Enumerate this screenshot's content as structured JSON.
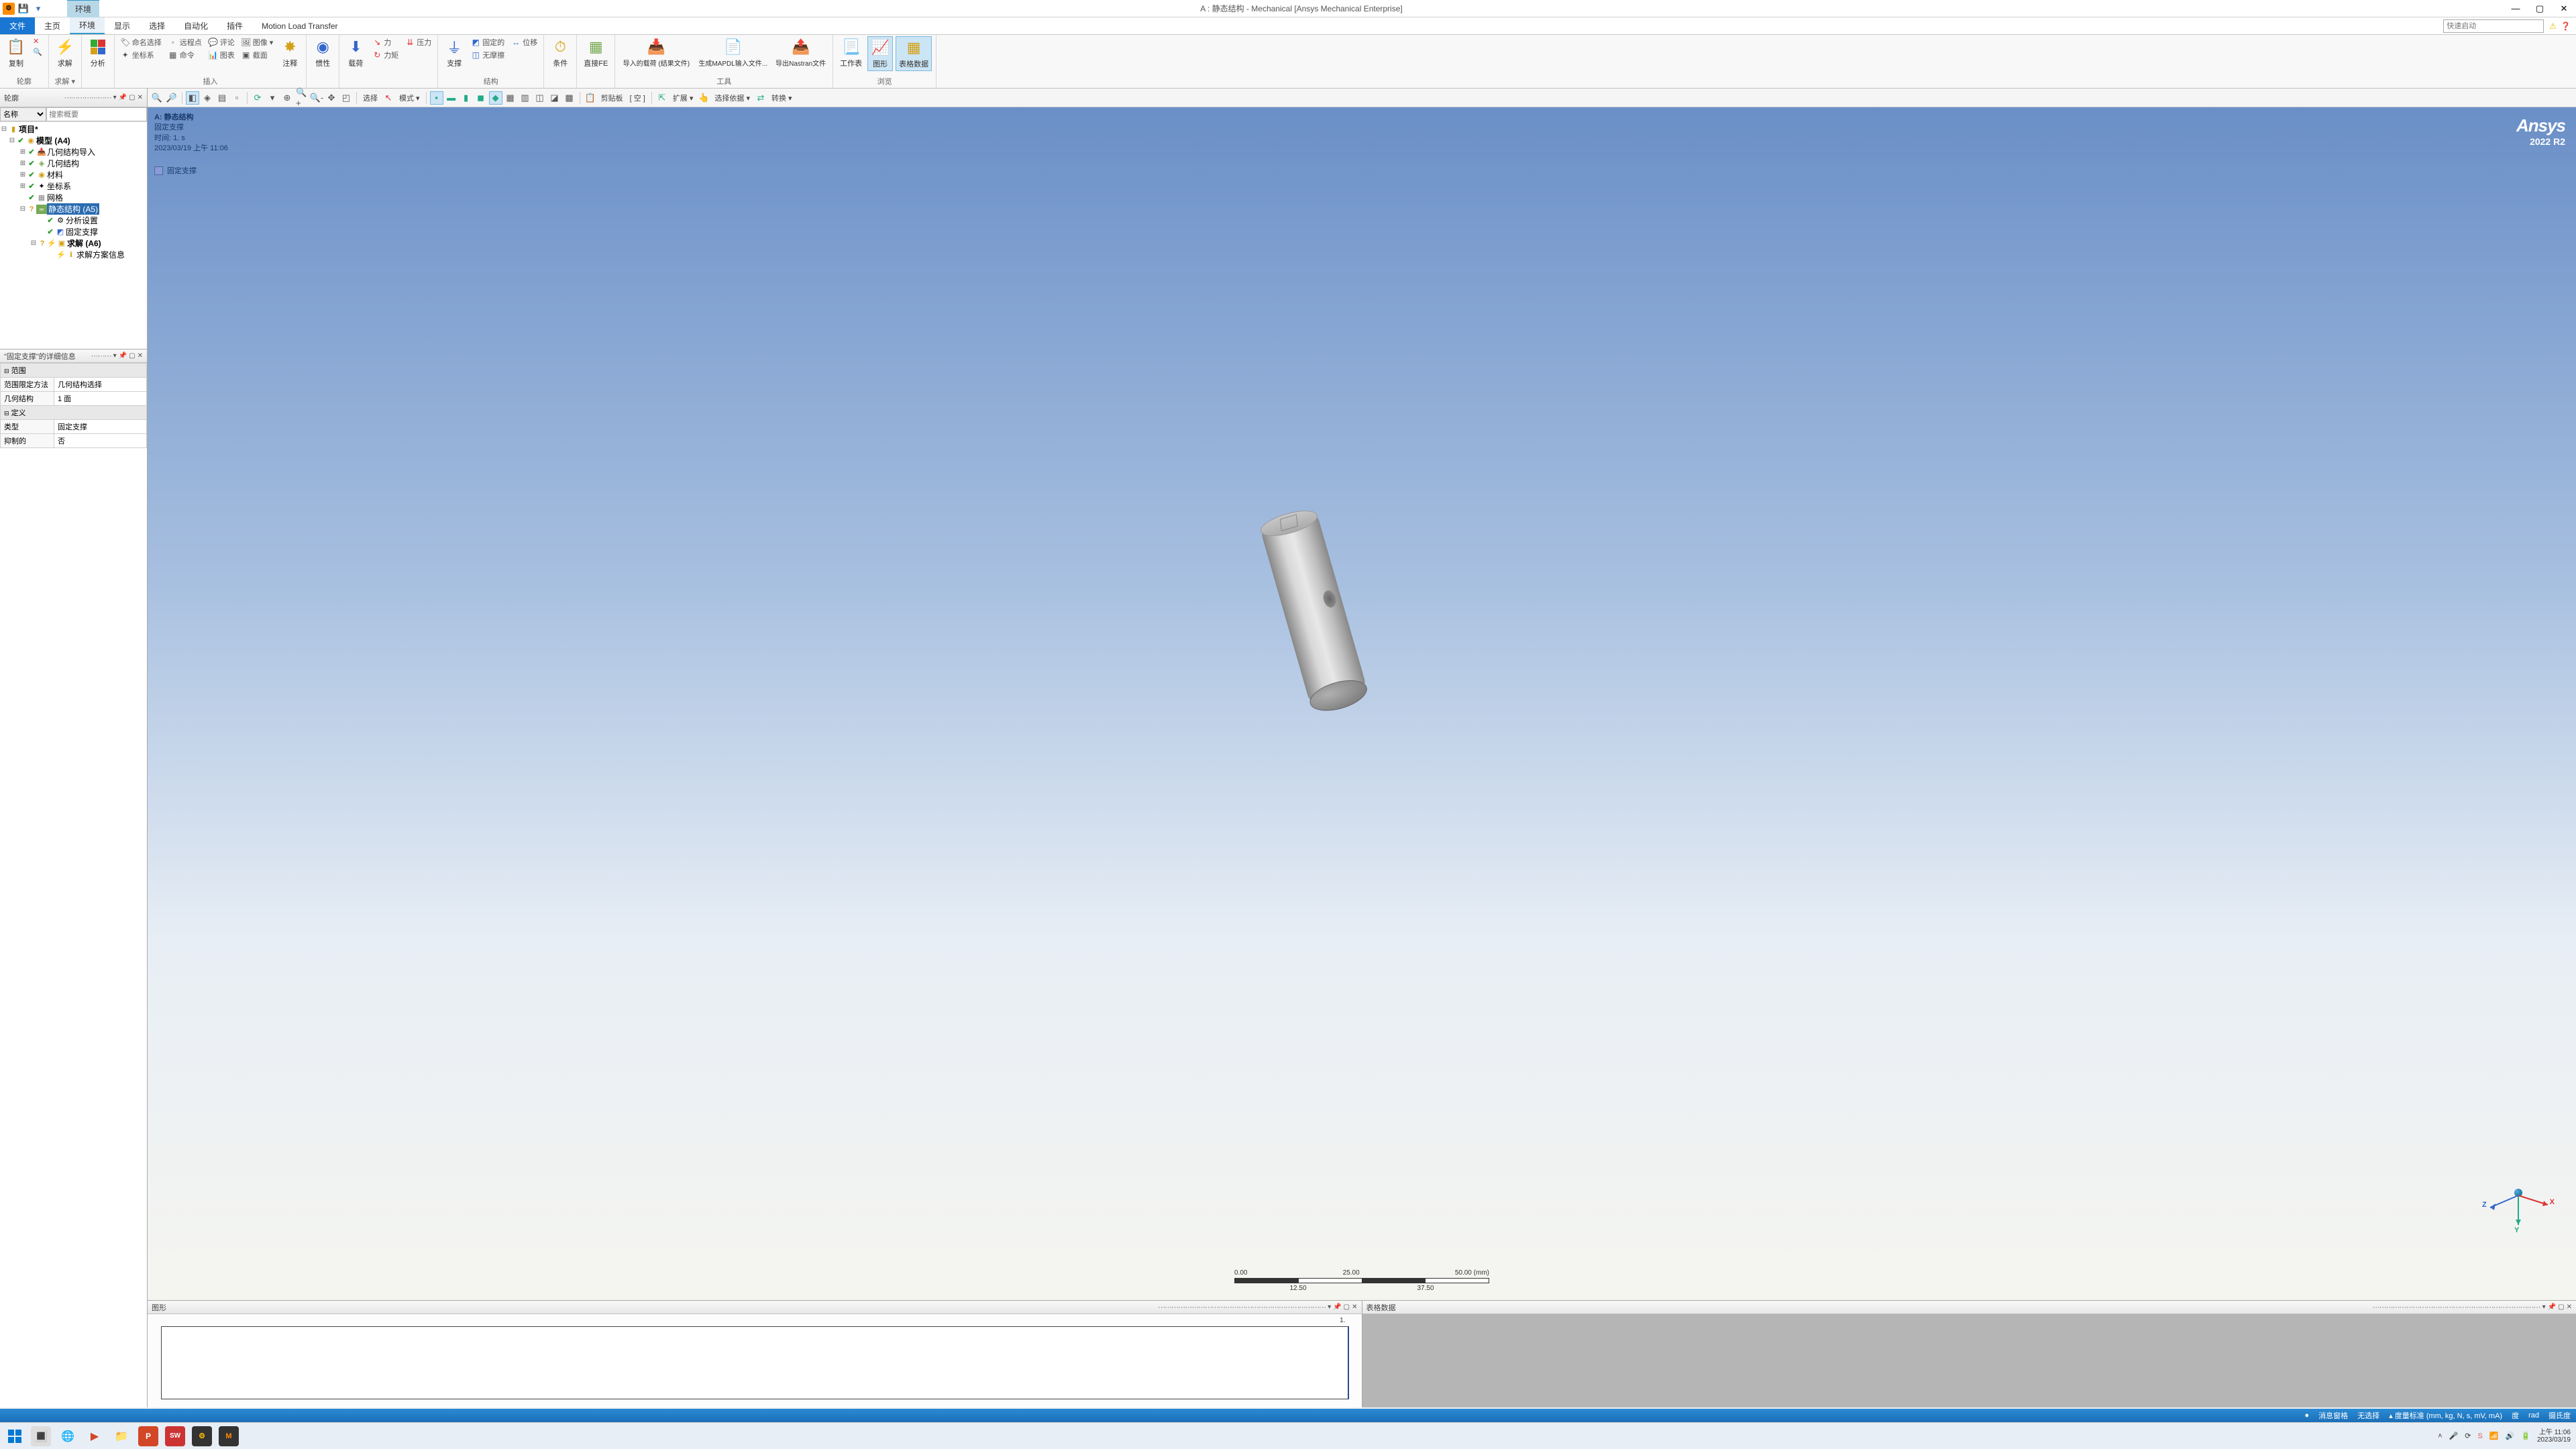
{
  "app": {
    "title": "A : 静态结构 - Mechanical [Ansys Mechanical Enterprise]",
    "context_tab": "环境",
    "logo_brand": "Ansys",
    "logo_version": "2022 R2"
  },
  "menu": {
    "file": "文件",
    "tabs": [
      "主页",
      "环境",
      "显示",
      "选择",
      "自动化",
      "插件",
      "Motion Load Transfer"
    ],
    "active": "环境",
    "quick_launch_placeholder": "快速启动"
  },
  "ribbon": {
    "g_outline": {
      "copy": "复制",
      "q": "Q",
      "label": "轮廓"
    },
    "g_solve": {
      "solve": "求解",
      "label": "求解 ▾"
    },
    "g_analysis": {
      "analyze": "分析",
      "label": ""
    },
    "g_insert": {
      "name_sel": "命名选择",
      "remote_pt": "远程点",
      "comment": "评论",
      "image": "图像 ▾",
      "coord": "坐标系",
      "cmd": "命令",
      "chart": "图表",
      "section": "截面",
      "annot": "注释",
      "label": "插入"
    },
    "g_inertia": {
      "inertia": "惯性",
      "label": ""
    },
    "g_loads": {
      "loads": "载荷",
      "force": "力",
      "moment": "力矩",
      "pressure": "压力",
      "label": ""
    },
    "g_support": {
      "support": "支撑",
      "fixed": "固定的",
      "frictionless": "无摩擦",
      "disp": "位移",
      "label": "结构"
    },
    "g_cond": {
      "cond": "条件",
      "label": ""
    },
    "g_fe": {
      "fe": "直接FE",
      "label": ""
    },
    "g_tools": {
      "import_load": "导入的载荷 (结果文件)",
      "mapdl": "生成MAPDL输入文件...",
      "nastran": "导出Nastran文件",
      "label": "工具"
    },
    "g_view": {
      "ws": "工作表",
      "graph": "图形",
      "table": "表格数据",
      "label": "浏览"
    }
  },
  "toolbar2": {
    "select": "选择",
    "mode": "模式 ▾",
    "clipboard": "剪贴板",
    "empty": "[ 空 ]",
    "extend": "扩展 ▾",
    "sel_by": "选择依据 ▾",
    "convert": "转换 ▾"
  },
  "outline": {
    "title": "轮廓",
    "name_filter": "名称",
    "search_placeholder": "搜索概要",
    "project": "项目*",
    "model": "模型 (A4)",
    "geom_import": "几何结构导入",
    "geometry": "几何结构",
    "materials": "材料",
    "coord_sys": "坐标系",
    "mesh": "网格",
    "static_struct": "静态结构 (A5)",
    "analysis_settings": "分析设置",
    "fixed_support": "固定支撑",
    "solution": "求解 (A6)",
    "solution_info": "求解方案信息"
  },
  "details": {
    "title": "\"固定支撑\"的详细信息",
    "scope_hdr": "范围",
    "scope_method_k": "范围限定方法",
    "scope_method_v": "几何结构选择",
    "geom_k": "几何结构",
    "geom_v": "1 面",
    "def_hdr": "定义",
    "type_k": "类型",
    "type_v": "固定支撑",
    "suppress_k": "抑制的",
    "suppress_v": "否"
  },
  "viewport": {
    "line1": "A: 静态结构",
    "line2": "固定支撑",
    "line3": "时间: 1. s",
    "line4": "2023/03/19 上午 11:06",
    "legend": "固定支撑",
    "scale": {
      "t0": "0.00",
      "t1": "25.00",
      "t2": "50.00",
      "unit": "(mm)",
      "b0": "12.50",
      "b1": "37.50"
    },
    "axes": {
      "x": "X",
      "y": "Y",
      "z": "Z"
    }
  },
  "graph_panel": {
    "title": "图形",
    "tick": "1."
  },
  "table_panel": {
    "title": "表格数据"
  },
  "status": {
    "msg_win": "消息窗格",
    "no_sel": "无选择",
    "units": "度量标准 (mm, kg, N, s, mV, mA)",
    "deg": "度",
    "rad": "rad",
    "celsius": "摄氏度"
  },
  "taskbar": {
    "time": "上午 11:06",
    "date": "2023/03/19"
  }
}
